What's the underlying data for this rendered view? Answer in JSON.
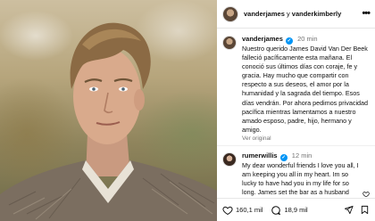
{
  "post": {
    "header": {
      "user1": "vanderjames",
      "separator": " y ",
      "user2": "vanderkimberly"
    },
    "caption": {
      "username": "vanderjames",
      "time": "20 min",
      "text": "Nuestro querido James David Van Der Beek falleció pacíficamente esta mañana. El conoció sus últimos días con coraje, fe y gracia. Hay mucho que compartir con respecto a sus deseos, el amor por la humanidad y la sagrada del tiempo. Esos días vendrán. Por ahora pedimos privacidad pacífica mientras lamentamos a nuestro amado esposo, padre, hijo, hermano y amigo.",
      "see_original": "Ver original"
    },
    "comment": {
      "username": "rumerwillis",
      "time": "12 min",
      "text": "My dear wonderful friends I love you all, I am keeping you all in my heart. Im so lucky to have had you in my life for so long. James set the bar as a husband and a father and"
    },
    "actions": {
      "likes": "160,1 mil",
      "comments": "18,9 mil"
    }
  },
  "icons": {
    "more": "more-options-icon",
    "verified": "verified-badge-icon",
    "like": "heart-icon",
    "comment": "comment-bubble-icon",
    "share": "share-icon",
    "save": "bookmark-icon"
  },
  "colors": {
    "verified": "#0095f6",
    "muted": "#737373"
  }
}
